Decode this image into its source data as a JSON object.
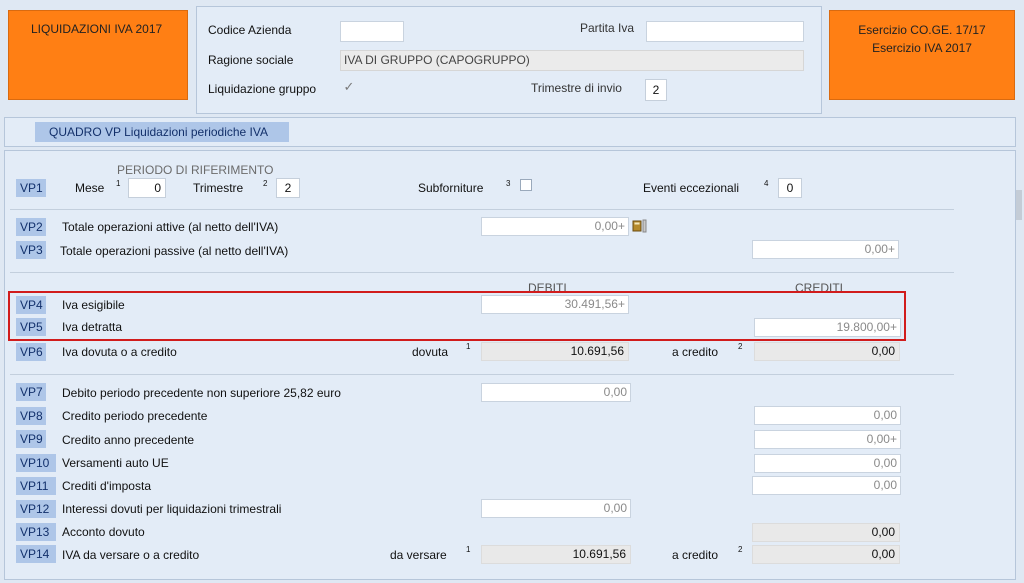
{
  "header": {
    "left_title": "LIQUIDAZIONI IVA 2017",
    "codice_azienda_label": "Codice  Azienda",
    "partita_iva_label": "Partita Iva",
    "ragione_sociale_label": "Ragione sociale",
    "ragione_sociale_value": "IVA DI GRUPPO (CAPOGRUPPO)",
    "liquidazione_gruppo_label": "Liquidazione  gruppo",
    "trimestre_invio_label": "Trimestre di invio",
    "trimestre_invio_value": "2",
    "esercizio_coge": "Esercizio CO.GE. 17/17",
    "esercizio_iva": "Esercizio IVA 2017"
  },
  "quadro_title": "QUADRO VP Liquidazioni periodiche IVA",
  "vp1": {
    "code": "VP1",
    "periodo_label": "PERIODO DI RIFERIMENTO",
    "mese_label": "Mese",
    "mese_sup": "1",
    "mese_value": "0",
    "trimestre_label": "Trimestre",
    "trimestre_sup": "2",
    "trimestre_value": "2",
    "subforniture_label": "Subforniture",
    "subforniture_sup": "3",
    "eventi_label": "Eventi eccezionali",
    "eventi_sup": "4",
    "eventi_value": "0"
  },
  "vp2": {
    "code": "VP2",
    "label": "Totale operazioni attive (al netto dell'IVA)",
    "value": "0,00+"
  },
  "vp3": {
    "code": "VP3",
    "label": "Totale operazioni passive (al netto dell'IVA)",
    "value": "0,00+"
  },
  "col_headers": {
    "debiti": "DEBITI",
    "crediti": "CREDITI"
  },
  "vp4": {
    "code": "VP4",
    "label": "Iva esigibile",
    "value": "30.491,56+"
  },
  "vp5": {
    "code": "VP5",
    "label": "Iva detratta",
    "value": "19.800,00+"
  },
  "vp6": {
    "code": "VP6",
    "label": "Iva dovuta o a credito",
    "dovuta_label": "dovuta",
    "dovuta_sup": "1",
    "dovuta_value": "10.691,56",
    "credito_label": "a credito",
    "credito_sup": "2",
    "credito_value": "0,00"
  },
  "vp7": {
    "code": "VP7",
    "label": "Debito periodo precedente non superiore 25,82 euro",
    "value": "0,00"
  },
  "vp8": {
    "code": "VP8",
    "label": "Credito periodo precedente",
    "value": "0,00"
  },
  "vp9": {
    "code": "VP9",
    "label": "Credito anno precedente",
    "value": "0,00+"
  },
  "vp10": {
    "code": "VP10",
    "label": "Versamenti auto UE",
    "value": "0,00"
  },
  "vp11": {
    "code": "VP11",
    "label": "Crediti d'imposta",
    "value": "0,00"
  },
  "vp12": {
    "code": "VP12",
    "label": "Interessi dovuti per liquidazioni trimestrali",
    "value": "0,00"
  },
  "vp13": {
    "code": "VP13",
    "label": "Acconto dovuto",
    "value": "0,00"
  },
  "vp14": {
    "code": "VP14",
    "label": "IVA da versare o a credito",
    "versare_label": "da versare",
    "versare_sup": "1",
    "versare_value": "10.691,56",
    "credito_label": "a credito",
    "credito_sup": "2",
    "credito_value": "0,00"
  }
}
